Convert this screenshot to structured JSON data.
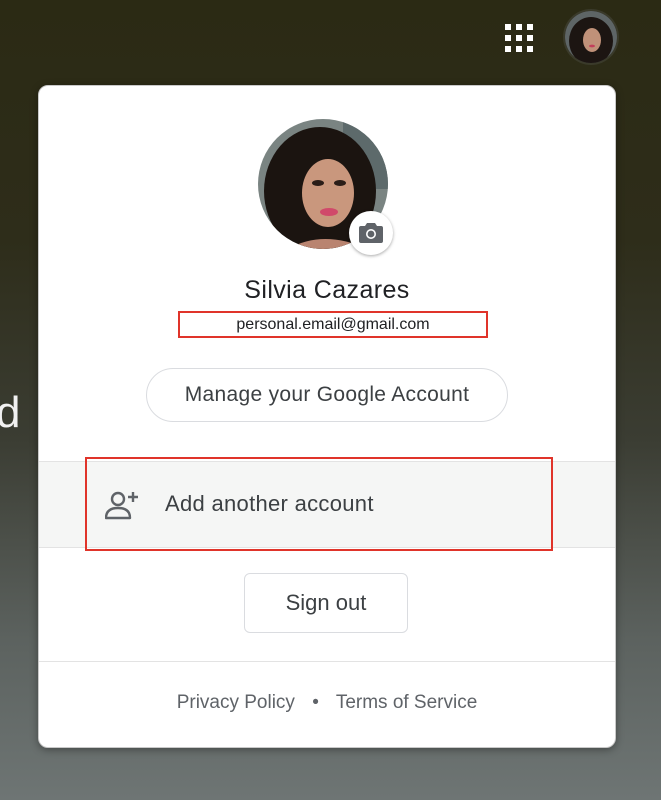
{
  "background": {
    "partial_text": "d b"
  },
  "header": {
    "apps_icon": "apps-grid-icon",
    "avatar_icon": "profile-avatar"
  },
  "account": {
    "name": "Silvia Cazares",
    "email": "personal.email@gmail.com",
    "manage_label": "Manage your Google Account",
    "camera_icon": "camera-icon"
  },
  "add_account": {
    "label": "Add another account",
    "icon": "person-add-icon"
  },
  "sign_out": {
    "label": "Sign out"
  },
  "footer": {
    "privacy": "Privacy Policy",
    "separator": "•",
    "terms": "Terms of Service"
  },
  "colors": {
    "highlight": "#e0342a",
    "text": "#3c4043",
    "muted": "#5f6368"
  }
}
